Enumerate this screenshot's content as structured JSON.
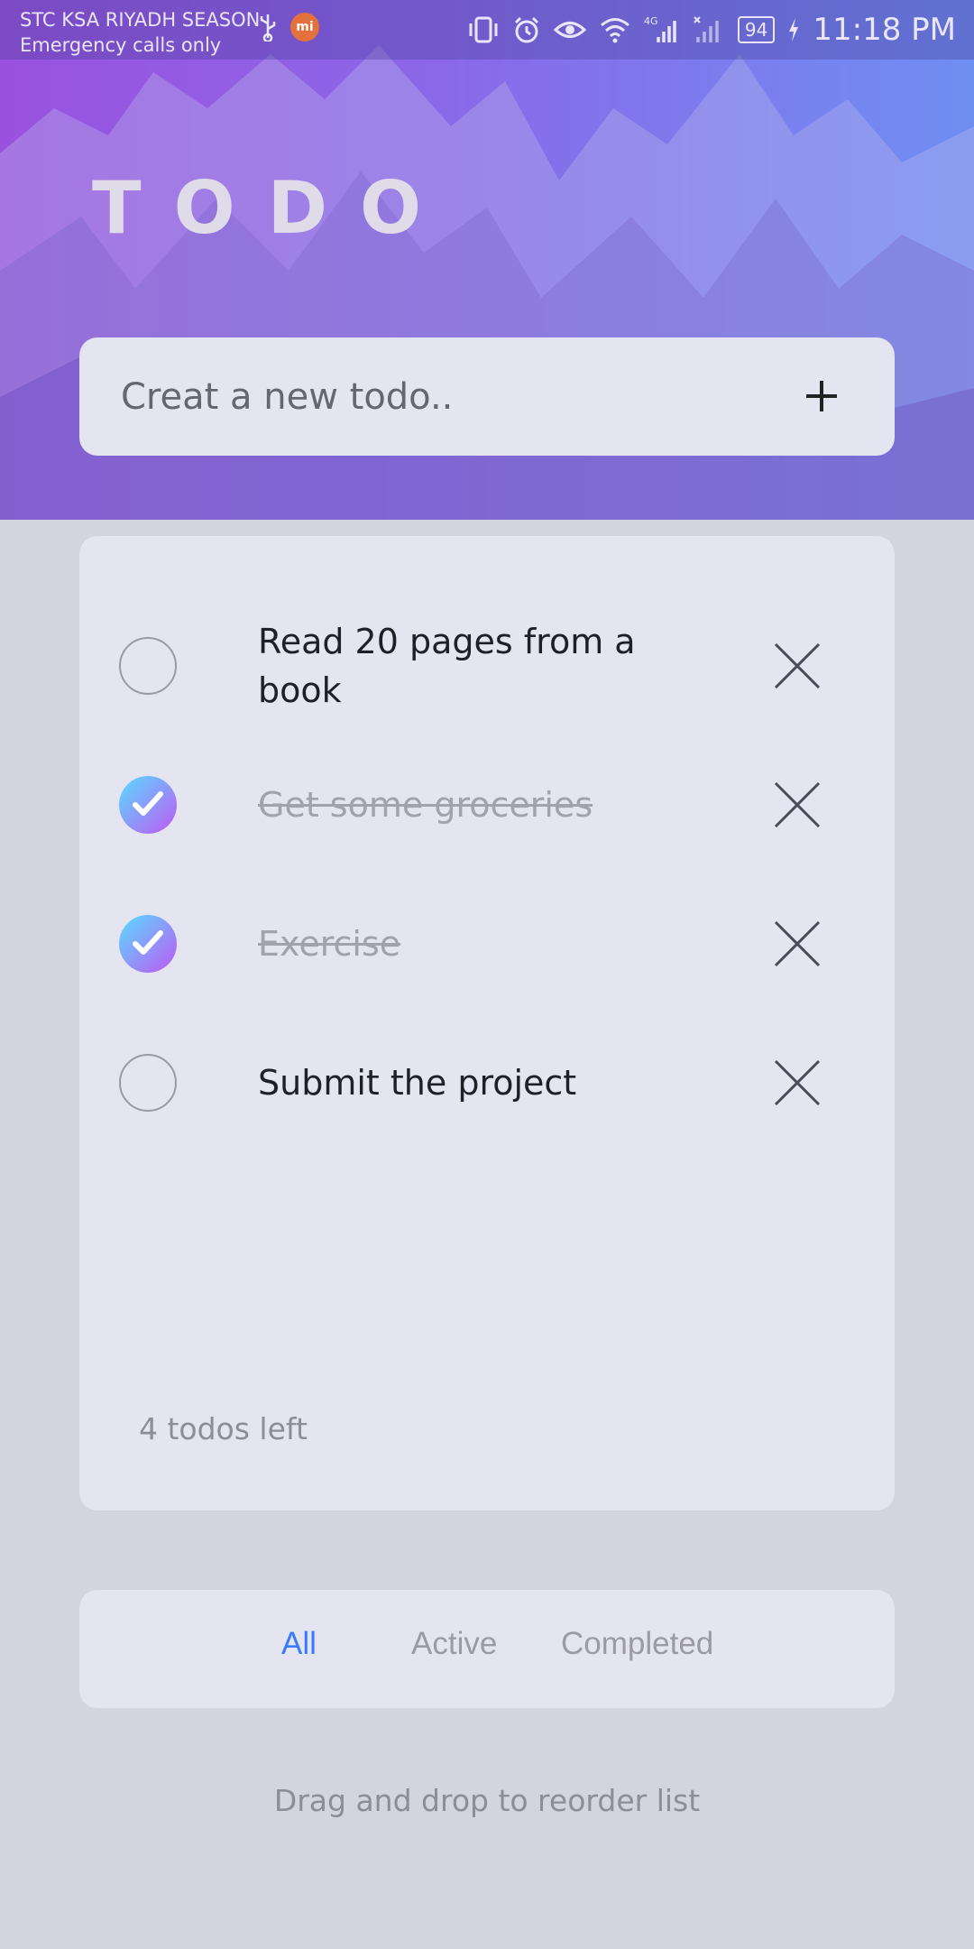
{
  "status_bar": {
    "carrier": "STC KSA RIYADH SEASON",
    "subtext": "Emergency calls only",
    "battery": "94",
    "time": "11:18 PM",
    "network": "4G"
  },
  "header": {
    "title": "TODO"
  },
  "new_todo": {
    "placeholder": "Creat a new todo.."
  },
  "todos": [
    {
      "text": "Read 20 pages from a book",
      "completed": false
    },
    {
      "text": "Get some groceries",
      "completed": true
    },
    {
      "text": "Exercise",
      "completed": true
    },
    {
      "text": "Submit the project",
      "completed": false
    }
  ],
  "footer": {
    "items_left": "4 todos left"
  },
  "filters": {
    "all": "All",
    "active": "Active",
    "completed": "Completed",
    "selected": "All"
  },
  "hint": "Drag and drop to reorder list",
  "colors": {
    "accent": "#3a7bfd",
    "check_gradient_start": "#57ddff",
    "check_gradient_end": "#c058f3"
  }
}
